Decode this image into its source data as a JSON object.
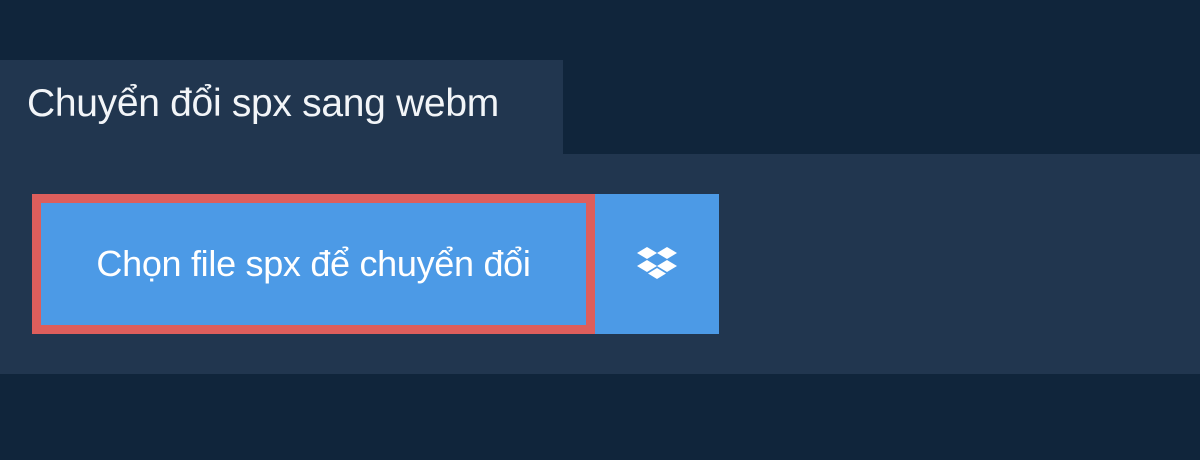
{
  "header": {
    "title": "Chuyển đổi spx sang webm"
  },
  "converter": {
    "choose_file_label": "Chọn file spx để chuyển đổi",
    "dropbox_icon": "dropbox-icon"
  },
  "colors": {
    "background": "#10253b",
    "panel": "#21364f",
    "button": "#4c9ae6",
    "focus_border": "#dd5e5c",
    "text": "#ffffff"
  }
}
